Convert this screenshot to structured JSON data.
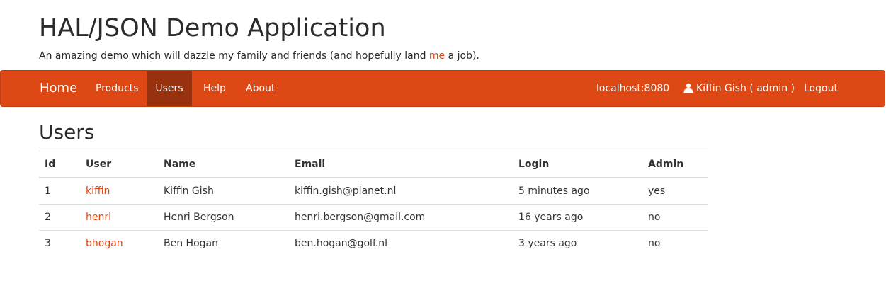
{
  "header": {
    "title": "HAL/JSON Demo Application",
    "tagline_before": "An amazing demo which will dazzle my family and friends (and hopefully land ",
    "tagline_link": "me",
    "tagline_after": " a job)."
  },
  "navbar": {
    "brand": "Home",
    "items": [
      {
        "label": "Products"
      },
      {
        "label": "Users",
        "active": true
      },
      {
        "label": "Help"
      },
      {
        "label": "About"
      }
    ],
    "host": "localhost:8080",
    "user_icon": "user-icon",
    "user_label": "Kiffin Gish ( admin )",
    "logout": "Logout",
    "accent_color": "#dd4814",
    "active_color": "#97310e"
  },
  "page": {
    "title": "Users"
  },
  "table": {
    "headers": [
      "Id",
      "User",
      "Name",
      "Email",
      "Login",
      "Admin"
    ],
    "rows": [
      {
        "id": "1",
        "user": "kiffin",
        "name": "Kiffin Gish",
        "email": "kiffin.gish@planet.nl",
        "login": "5 minutes ago",
        "admin": "yes"
      },
      {
        "id": "2",
        "user": "henri",
        "name": "Henri Bergson",
        "email": "henri.bergson@gmail.com",
        "login": "16 years ago",
        "admin": "no"
      },
      {
        "id": "3",
        "user": "bhogan",
        "name": "Ben Hogan",
        "email": "ben.hogan@golf.nl",
        "login": "3 years ago",
        "admin": "no"
      }
    ]
  }
}
